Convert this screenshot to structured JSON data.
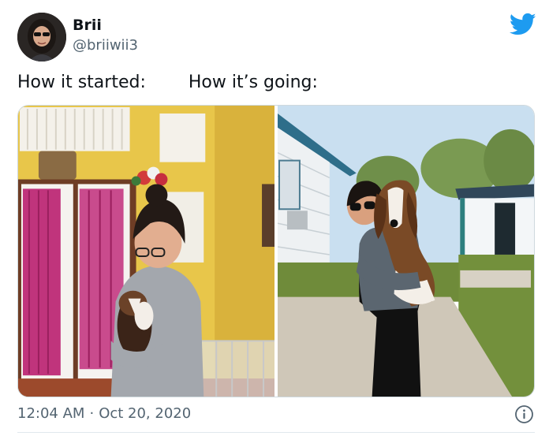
{
  "author": {
    "display_name": "Brii",
    "handle": "@briiwii3",
    "avatar_icon": "profile-photo"
  },
  "tweet": {
    "text_left": "How it started:",
    "text_right": "How it’s going:",
    "time": "12:04 AM",
    "separator": "·",
    "date": "Oct 20, 2020"
  },
  "icons": {
    "brand": "twitter-bird-icon",
    "info": "info-icon"
  },
  "colors": {
    "brand_blue": "#1d9bf0",
    "secondary_text": "#536471",
    "primary_text": "#0f1419",
    "border": "#cfd9de"
  }
}
